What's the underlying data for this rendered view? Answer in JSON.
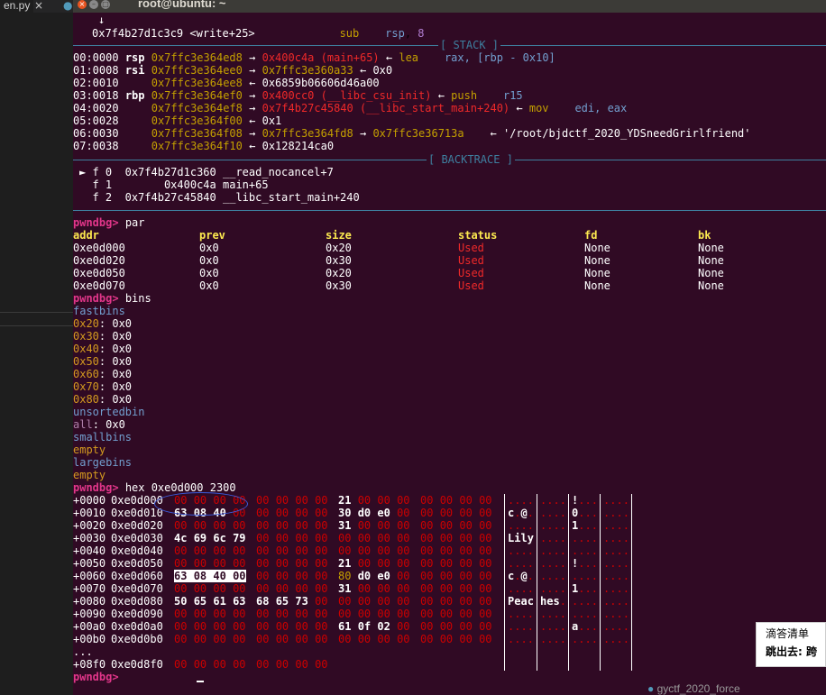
{
  "editor": {
    "tab_label": "en.py",
    "tab_close_icon": "×",
    "tab2_icon": "python-icon"
  },
  "window": {
    "title": "root@ubuntu: ~"
  },
  "disasm": {
    "arrow": "↓",
    "addr": "0x7f4b27d1c3c9",
    "sym": "<write+25>",
    "mnem": "sub",
    "op1": "rsp",
    "op2": "8"
  },
  "stack": {
    "header": "[ STACK ]",
    "rows": [
      {
        "off": "00:0000",
        "reg": "rsp",
        "a": "0x7ffc3e364ed8",
        "arrow1": "→",
        "b": "0x400c4a",
        "bsym": "(main+65)",
        "arrow2": "←",
        "mnem": "lea",
        "ops": "rax, [rbp - 0x10]"
      },
      {
        "off": "01:0008",
        "reg": "rsi",
        "a": "0x7ffc3e364ee0",
        "arrow1": "→",
        "b": "0x7ffc3e360a33",
        "bsym": "",
        "arrow2": "←",
        "mnem": "",
        "ops": "0x0"
      },
      {
        "off": "02:0010",
        "reg": "",
        "a": "0x7ffc3e364ee8",
        "arrow1": "←",
        "b": "0x6859b06606d46a00",
        "bsym": "",
        "arrow2": "",
        "mnem": "",
        "ops": ""
      },
      {
        "off": "03:0018",
        "reg": "rbp",
        "a": "0x7ffc3e364ef0",
        "arrow1": "→",
        "b": "0x400cc0",
        "bsym": "(__libc_csu_init)",
        "arrow2": "←",
        "mnem": "push",
        "ops": "r15"
      },
      {
        "off": "04:0020",
        "reg": "",
        "a": "0x7ffc3e364ef8",
        "arrow1": "→",
        "b": "0x7f4b27c45840",
        "bsym": "(__libc_start_main+240)",
        "arrow2": "←",
        "mnem": "mov",
        "ops": "edi, eax"
      },
      {
        "off": "05:0028",
        "reg": "",
        "a": "0x7ffc3e364f00",
        "arrow1": "←",
        "b": "0x1",
        "bsym": "",
        "arrow2": "",
        "mnem": "",
        "ops": ""
      },
      {
        "off": "06:0030",
        "reg": "",
        "a": "0x7ffc3e364f08",
        "arrow1": "→",
        "b": "0x7ffc3e364fd8",
        "bsym": "",
        "arrow2": "→",
        "mnem": "0x7ffc3e36713a",
        "ops": "← '/root/bjdctf_2020_YDSneedGrirlfriend'"
      },
      {
        "off": "07:0038",
        "reg": "",
        "a": "0x7ffc3e364f10",
        "arrow1": "←",
        "b": "0x128214ca0",
        "bsym": "",
        "arrow2": "",
        "mnem": "",
        "ops": ""
      }
    ]
  },
  "backtrace": {
    "header": "[ BACKTRACE ]",
    "rows": [
      {
        "marker": "►",
        "frame": "f 0",
        "addr": "0x7f4b27d1c360",
        "sym": "__read_nocancel+7"
      },
      {
        "marker": "",
        "frame": "f 1",
        "addr": "0x400c4a",
        "sym": "main+65"
      },
      {
        "marker": "",
        "frame": "f 2",
        "addr": "0x7f4b27c45840",
        "sym": "__libc_start_main+240"
      }
    ]
  },
  "prompt": "pwndbg>",
  "par": {
    "cmd": "par",
    "headers": [
      "addr",
      "prev",
      "size",
      "status",
      "fd",
      "bk"
    ],
    "rows": [
      [
        "0xe0d000",
        "0x0",
        "0x20",
        "Used",
        "None",
        "None"
      ],
      [
        "0xe0d020",
        "0x0",
        "0x30",
        "Used",
        "None",
        "None"
      ],
      [
        "0xe0d050",
        "0x0",
        "0x20",
        "Used",
        "None",
        "None"
      ],
      [
        "0xe0d070",
        "0x0",
        "0x30",
        "Used",
        "None",
        "None"
      ]
    ]
  },
  "bins": {
    "cmd": "bins",
    "fastbins_label": "fastbins",
    "fast": [
      {
        "size": "0x20",
        "val": "0x0"
      },
      {
        "size": "0x30",
        "val": "0x0"
      },
      {
        "size": "0x40",
        "val": "0x0"
      },
      {
        "size": "0x50",
        "val": "0x0"
      },
      {
        "size": "0x60",
        "val": "0x0"
      },
      {
        "size": "0x70",
        "val": "0x0"
      },
      {
        "size": "0x80",
        "val": "0x0"
      }
    ],
    "unsorted_label": "unsortedbin",
    "all_label": "all",
    "all_val": "0x0",
    "small_label": "smallbins",
    "small_val": "empty",
    "large_label": "largebins",
    "large_val": "empty"
  },
  "hex": {
    "cmd": "hex 0xe0d000 2300",
    "rows": [
      {
        "off": "+0000",
        "addr": "0xe0d000",
        "g1": "00 00 00 00",
        "g2": "00 00 00 00",
        "g3": "21 00 00 00",
        "g4": "00 00 00 00",
        "a1": "....",
        "a2": "....",
        "a3": "!...",
        "a4": "...."
      },
      {
        "off": "+0010",
        "addr": "0xe0d010",
        "g1": "63 08 40 00",
        "g2": "00 00 00 00",
        "g3": "30 d0 e0 00",
        "g4": "00 00 00 00",
        "a1": "c.@.",
        "a2": "....",
        "a3": "0...",
        "a4": "...."
      },
      {
        "off": "+0020",
        "addr": "0xe0d020",
        "g1": "00 00 00 00",
        "g2": "00 00 00 00",
        "g3": "31 00 00 00",
        "g4": "00 00 00 00",
        "a1": "....",
        "a2": "....",
        "a3": "1...",
        "a4": "...."
      },
      {
        "off": "+0030",
        "addr": "0xe0d030",
        "g1": "4c 69 6c 79",
        "g2": "00 00 00 00",
        "g3": "00 00 00 00",
        "g4": "00 00 00 00",
        "a1": "Lily",
        "a2": "....",
        "a3": "....",
        "a4": "...."
      },
      {
        "off": "+0040",
        "addr": "0xe0d040",
        "g1": "00 00 00 00",
        "g2": "00 00 00 00",
        "g3": "00 00 00 00",
        "g4": "00 00 00 00",
        "a1": "....",
        "a2": "....",
        "a3": "....",
        "a4": "...."
      },
      {
        "off": "+0050",
        "addr": "0xe0d050",
        "g1": "00 00 00 00",
        "g2": "00 00 00 00",
        "g3": "21 00 00 00",
        "g4": "00 00 00 00",
        "a1": "....",
        "a2": "....",
        "a3": "!...",
        "a4": "...."
      },
      {
        "off": "+0060",
        "addr": "0xe0d060",
        "g1": "63 08 40 00",
        "g2": "00 00 00 00",
        "g3": "80 d0 e0 00",
        "g4": "00 00 00 00",
        "a1": "c.@.",
        "a2": "....",
        "a3": "....",
        "a4": "...."
      },
      {
        "off": "+0070",
        "addr": "0xe0d070",
        "g1": "00 00 00 00",
        "g2": "00 00 00 00",
        "g3": "31 00 00 00",
        "g4": "00 00 00 00",
        "a1": "....",
        "a2": "....",
        "a3": "1...",
        "a4": "...."
      },
      {
        "off": "+0080",
        "addr": "0xe0d080",
        "g1": "50 65 61 63",
        "g2": "68 65 73 00",
        "g3": "00 00 00 00",
        "g4": "00 00 00 00",
        "a1": "Peac",
        "a2": "hes.",
        "a3": "....",
        "a4": "...."
      },
      {
        "off": "+0090",
        "addr": "0xe0d090",
        "g1": "00 00 00 00",
        "g2": "00 00 00 00",
        "g3": "00 00 00 00",
        "g4": "00 00 00 00",
        "a1": "....",
        "a2": "....",
        "a3": "....",
        "a4": "...."
      },
      {
        "off": "+00a0",
        "addr": "0xe0d0a0",
        "g1": "00 00 00 00",
        "g2": "00 00 00 00",
        "g3": "61 0f 02 00",
        "g4": "00 00 00 00",
        "a1": "....",
        "a2": "....",
        "a3": "a...",
        "a4": "...."
      },
      {
        "off": "+00b0",
        "addr": "0xe0d0b0",
        "g1": "00 00 00 00",
        "g2": "00 00 00 00",
        "g3": "00 00 00 00",
        "g4": "00 00 00 00",
        "a1": "....",
        "a2": "....",
        "a3": "....",
        "a4": "...."
      }
    ],
    "ellipsis": "...",
    "last": {
      "off": "+08f0",
      "addr": "0xe0d8f0",
      "g1": "00 00 00 00",
      "g2": "00 00 00 00",
      "g3": "",
      "g4": "",
      "a1": "",
      "a2": "",
      "a3": "",
      "a4": ""
    }
  },
  "popup": {
    "title": "滴答清单",
    "body": "跳出去: 跨"
  },
  "statusbar": {
    "file": "gyctf_2020_force"
  },
  "colors": {
    "terminal_bg": "#300a24",
    "address_yellow": "#c4a000",
    "code_red": "#ef2929",
    "prompt_pink": "#e2368a",
    "section_blue": "#3e7f9f"
  }
}
